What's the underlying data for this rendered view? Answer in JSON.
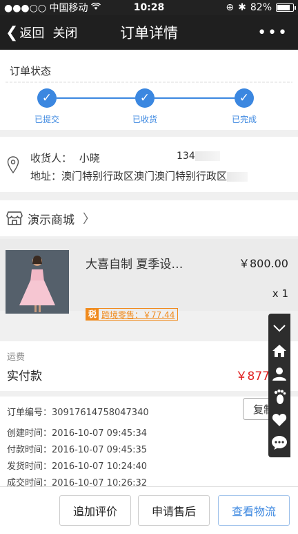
{
  "statusbar": {
    "carrier": "●●●○○ 中国移动",
    "time": "10:28",
    "battery_text": "82%",
    "battery_level": 0.82
  },
  "navbar": {
    "back_label": "返回",
    "close_label": "关闭",
    "title": "订单详情",
    "more_label": "•••"
  },
  "order_status": {
    "title": "订单状态",
    "steps": [
      "已提交",
      "已收货",
      "已完成"
    ],
    "accent_color": "#3b87e0"
  },
  "address": {
    "receiver_label": "收货人：",
    "receiver_name": "小晓",
    "phone": "134",
    "address_text": "地址：澳门特别行政区澳门澳门特别行政区"
  },
  "shop": {
    "name": "演示商城"
  },
  "product": {
    "name": "大喜自制 夏季设…",
    "price": "￥800.00",
    "quantity": "x 1",
    "tax_tag": "税",
    "tax_text": "跨境零售：￥77.44"
  },
  "payment": {
    "shipping_label": "运费",
    "paid_label": "实付款",
    "paid_value": "￥877.44",
    "price_color": "#e02020"
  },
  "order_info": {
    "order_no": "订单编号：30917614758047340",
    "copy_label": "复制",
    "created": "创建时间：2016-10-07 09:45:34",
    "paid": "付款时间：2016-10-07 09:45:35",
    "shipped": "发货时间：2016-10-07 10:24:40",
    "closed": "成交时间：2016-10-07 10:26:32"
  },
  "footer": {
    "review_label": "追加评价",
    "aftersale_label": "申请售后",
    "logistics_label": "查看物流"
  },
  "floatbar": {
    "icons": [
      "chevron-down-icon",
      "home-icon",
      "user-icon",
      "footprint-icon",
      "heart-icon",
      "chat-icon"
    ]
  }
}
